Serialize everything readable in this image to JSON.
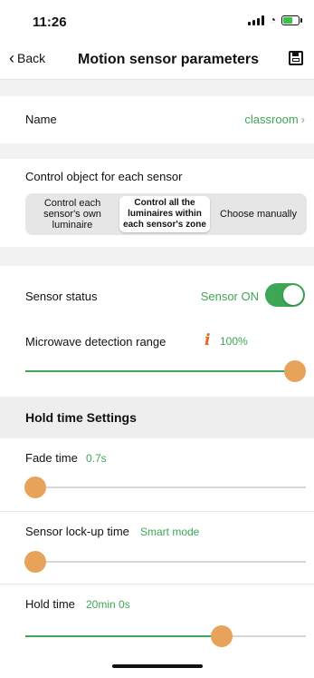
{
  "status_bar": {
    "time": "11:26",
    "battery": 0.7
  },
  "nav": {
    "back_label": "Back",
    "title": "Motion sensor parameters",
    "save_icon": "save-icon"
  },
  "name": {
    "label": "Name",
    "value": "classroom"
  },
  "control_object": {
    "title": "Control object for each sensor",
    "options": [
      "Control each sensor's own luminaire",
      "Control all the luminaires within each sensor's zone",
      "Choose manually"
    ],
    "selected_index": 1
  },
  "sensor_status": {
    "label": "Sensor status",
    "value": "Sensor ON",
    "on": true
  },
  "microwave": {
    "label": "Microwave detection range",
    "value": "100%",
    "level": 1.0,
    "info_icon": "info-icon"
  },
  "hold_time_settings": {
    "header": "Hold time Settings",
    "fade": {
      "label": "Fade time",
      "value": "0.7s",
      "level": 0.0
    },
    "lock_up": {
      "label": "Sensor lock-up time",
      "value": "Smart mode",
      "level": 0.0
    },
    "hold": {
      "label": "Hold time",
      "value": "20min 0s",
      "level": 0.7
    }
  },
  "colors": {
    "accent": "#3ea654",
    "thumb": "#e8a35a",
    "info": "#e56a1f"
  }
}
